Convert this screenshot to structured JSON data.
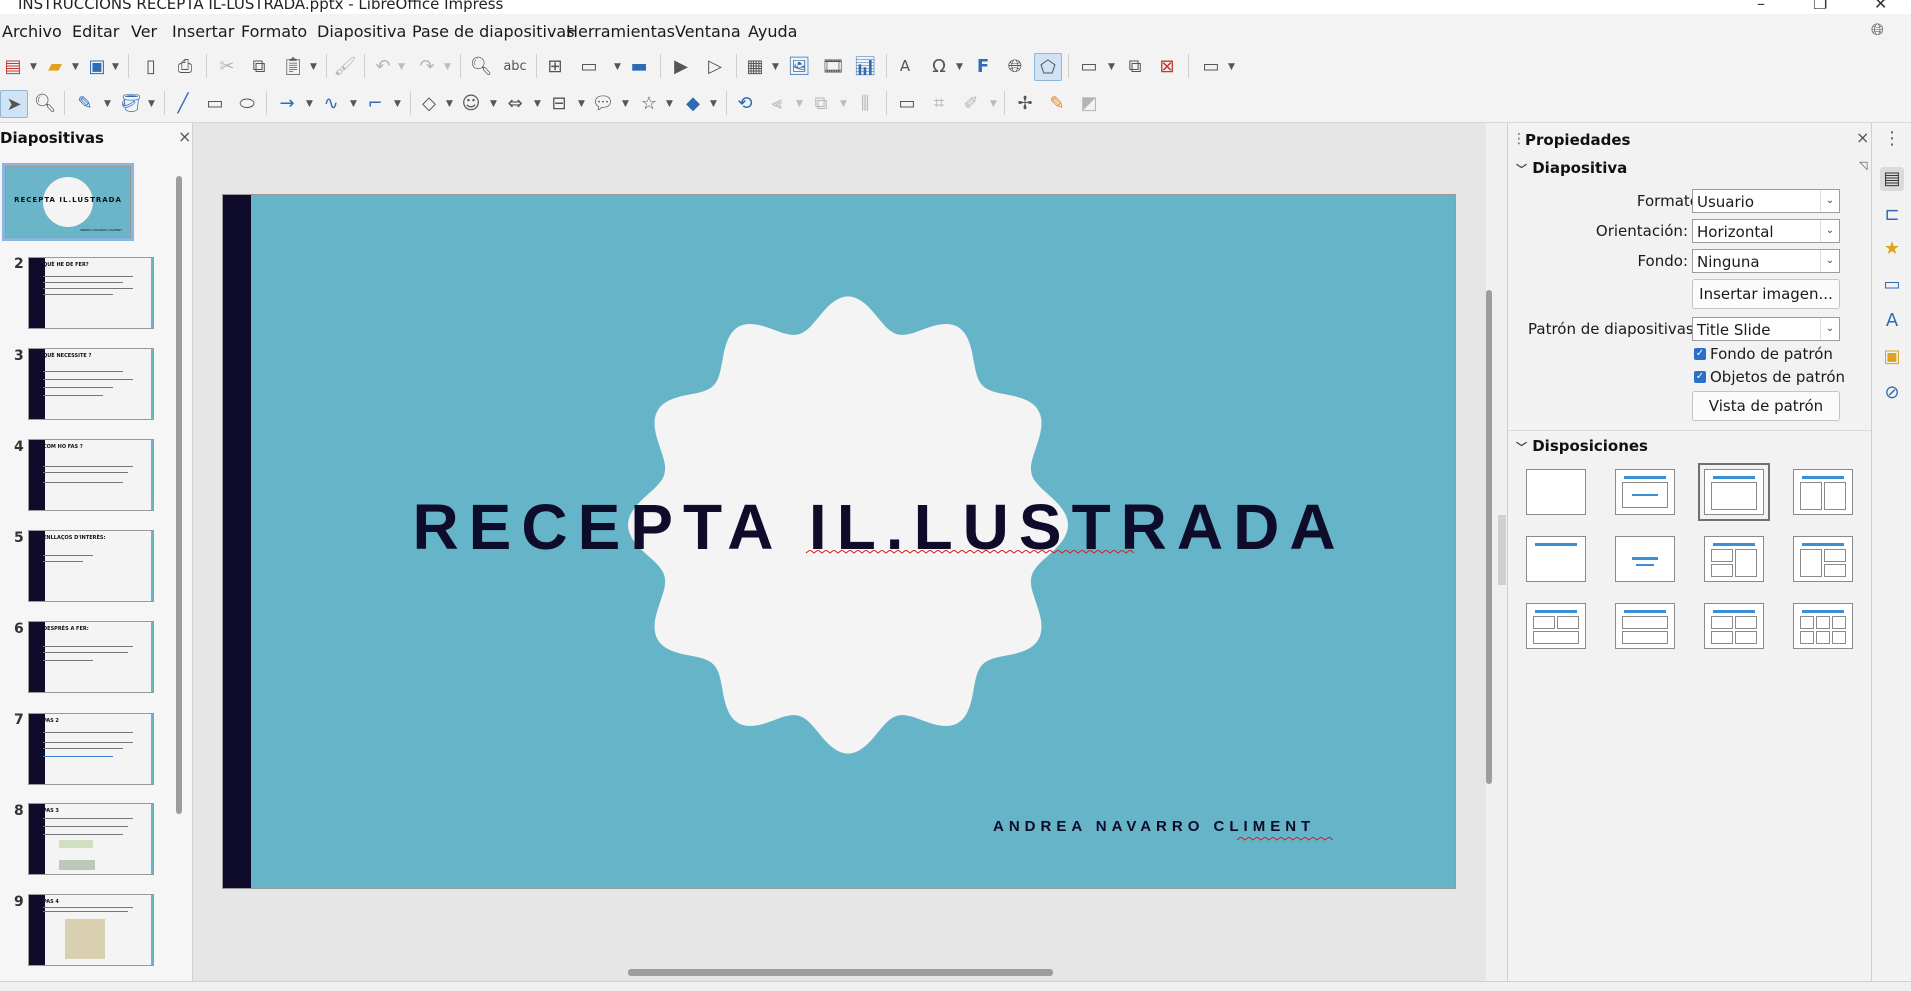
{
  "window": {
    "title": "INSTRUCCIONS RECEPTA IL-LUSTRADA.pptx - LibreOffice Impress",
    "minimize": "–",
    "maximize": "❐",
    "close": "✕"
  },
  "menu": [
    "Archivo",
    "Editar",
    "Ver",
    "Insertar",
    "Formato",
    "Diapositiva",
    "Pase de diapositivas",
    "Herramientas",
    "Ventana",
    "Ayuda"
  ],
  "slides_panel": {
    "title": "Diapositivas",
    "close": "×",
    "slides": [
      {
        "number": "1",
        "title": "RECEPTA IL.LUSTRADA"
      },
      {
        "number": "2",
        "title": "QUÈ HE DE FER?"
      },
      {
        "number": "3",
        "title": "QUÈ NECESSITE ?"
      },
      {
        "number": "4",
        "title": "COM HO FAS ?"
      },
      {
        "number": "5",
        "title": "ENLLAÇOS D'INTERÈS:"
      },
      {
        "number": "6",
        "title": "DESPRÉS A FER:"
      },
      {
        "number": "7",
        "title": "PAS 2"
      },
      {
        "number": "8",
        "title": "PAS 3"
      },
      {
        "number": "9",
        "title": "PAS 4"
      }
    ]
  },
  "slide": {
    "title": "RECEPTA IL.LUSTRADA",
    "subtitle": "ANDREA NAVARRO CLIMENT"
  },
  "properties": {
    "title": "Propiedades",
    "close": "×",
    "section_slide": "Diapositiva",
    "format_label": "Formato:",
    "format_value": "Usuario",
    "orientation_label": "Orientación:",
    "orientation_value": "Horizontal",
    "background_label": "Fondo:",
    "background_value": "Ninguna",
    "insert_image": "Insertar imagen...",
    "master_label": "Patrón de diapositivas:",
    "master_value": "Title Slide",
    "master_background": "Fondo de patrón",
    "master_objects": "Objetos de patrón",
    "master_view": "Vista de patrón",
    "section_layouts": "Disposiciones"
  },
  "colors": {
    "slide_bg": "#66b4c8",
    "slide_accent": "#0f0c2b",
    "shape_fill": "#f4f4f4"
  }
}
